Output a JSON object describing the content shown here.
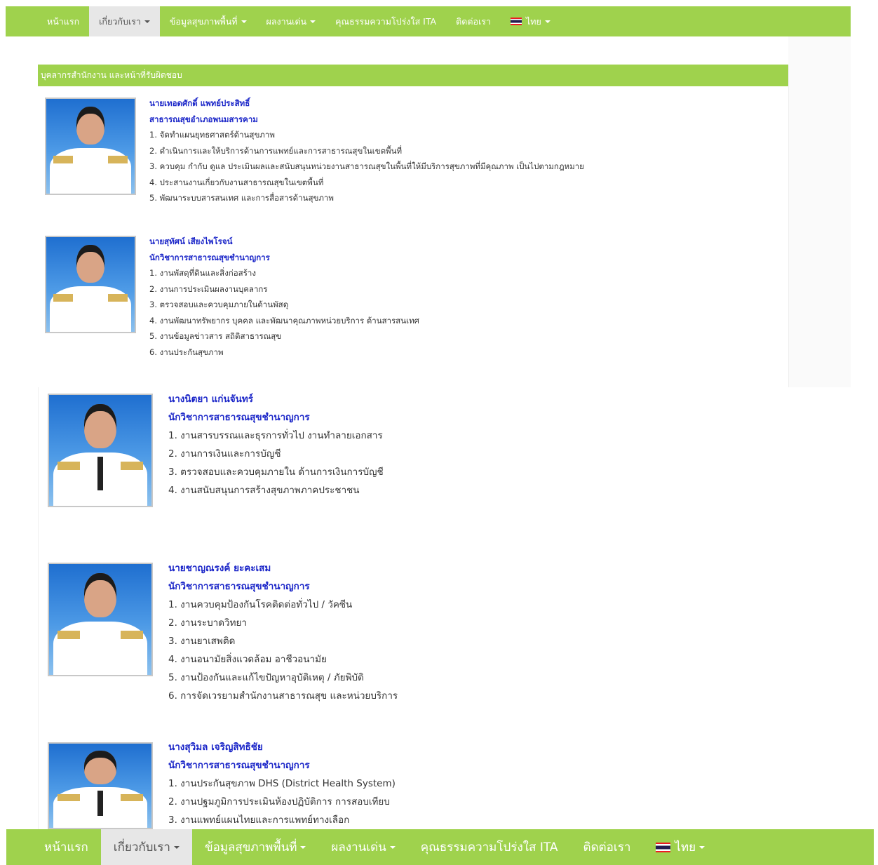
{
  "nav": {
    "items": [
      {
        "label": "หน้าแรก",
        "dropdown": false,
        "active": false
      },
      {
        "label": "เกี่ยวกับเรา",
        "dropdown": true,
        "active": true
      },
      {
        "label": "ข้อมูลสุขภาพพื้นที่",
        "dropdown": true,
        "active": false
      },
      {
        "label": "ผลงานเด่น",
        "dropdown": true,
        "active": false
      },
      {
        "label": "คุณธรรมความโปร่งใส ITA",
        "dropdown": false,
        "active": false
      },
      {
        "label": "ติดต่อเรา",
        "dropdown": false,
        "active": false
      }
    ],
    "language_label": "ไทย",
    "accent_color": "#9fd24d"
  },
  "panel": {
    "heading": "บุคลากรสำนักงาน และหน้าที่รับผิดชอบ"
  },
  "people": [
    {
      "name": "นายเทอดศักดิ์ แพทย์ประสิทธิ์",
      "title": "สาธารณสุขอำเภอพนมสารคาม",
      "duties": [
        "1. จัดทำแผนยุทธศาสตร์ด้านสุขภาพ",
        "2. ดำเนินการและให้บริการด้านการแพทย์และการสาธารณสุขในเขตพื้นที่",
        "3. ควบคุม กำกับ ดูแล ประเมินผลและสนับสนุนหน่วยงานสาธารณสุขในพื้นที่ให้มีบริการสุขภาพที่มีคุณภาพ เป็นไปตามกฎหมาย",
        "4. ประสานงานเกี่ยวกับงานสาธารณสุขในเขตพื้นที่",
        "5. พัฒนาระบบสารสนเทศ และการสื่อสารด้านสุขภาพ"
      ]
    },
    {
      "name": "นายสุทัศน์ เสียงไพโรจน์",
      "title": "นักวิชาการสาธารณสุขชำนาญการ",
      "duties": [
        "1. งานพัสดุที่ดินและสิ่งก่อสร้าง",
        "2. งานการประเมินผลงานบุคลากร",
        "3. ตรวจสอบและควบคุมภายในด้านพัสดุ",
        "4. งานพัฒนาทรัพยากร บุคคล และพัฒนาคุณภาพหน่วยบริการ ด้านสารสนเทศ",
        "5. งานข้อมูลข่าวสาร สถิติสาธารณสุข",
        "6. งานประกันสุขภาพ"
      ]
    },
    {
      "name": "นางนิตยา แก่นจันทร์",
      "title": "นักวิชาการสาธารณสุขชำนาญการ",
      "duties": [
        "1. งานสารบรรณและธุรการทั่วไป งานทำลายเอกสาร",
        "2. งานการเงินและการบัญชี",
        "3. ตรวจสอบและควบคุมภายใน ด้านการเงินการบัญชี",
        "4. งานสนับสนุนการสร้างสุขภาพภาคประชาชน"
      ]
    },
    {
      "name": "นายชาญณรงค์ ยะคะเสม",
      "title": "นักวิชาการสาธารณสุขชำนาญการ",
      "duties": [
        "1. งานควบคุมป้องกันโรคติดต่อทั่วไป / วัคซีน",
        "2. งานระบาดวิทยา",
        "3. งานยาเสพติด",
        "4. งานอนามัยสิ่งแวดล้อม อาชีวอนามัย",
        "5. งานป้องกันและแก้ไขปัญหาอุบัติเหตุ / ภัยพิบัติ",
        "6. การจัดเวรยามสำนักงานสาธารณสุข และหน่วยบริการ"
      ]
    },
    {
      "name": "นางสุวิมล เจริญสิทธิชัย",
      "title": "นักวิชาการสาธารณสุขชำนาญการ",
      "duties": [
        "1. งานประกันสุขภาพ DHS (District Health System)",
        "2. งานปฐมภูมิการประเมินห้องปฏิบัติการ การสอบเทียบ",
        "3. งานแพทย์แผนไทยและการแพทย์ทางเลือก"
      ]
    }
  ]
}
